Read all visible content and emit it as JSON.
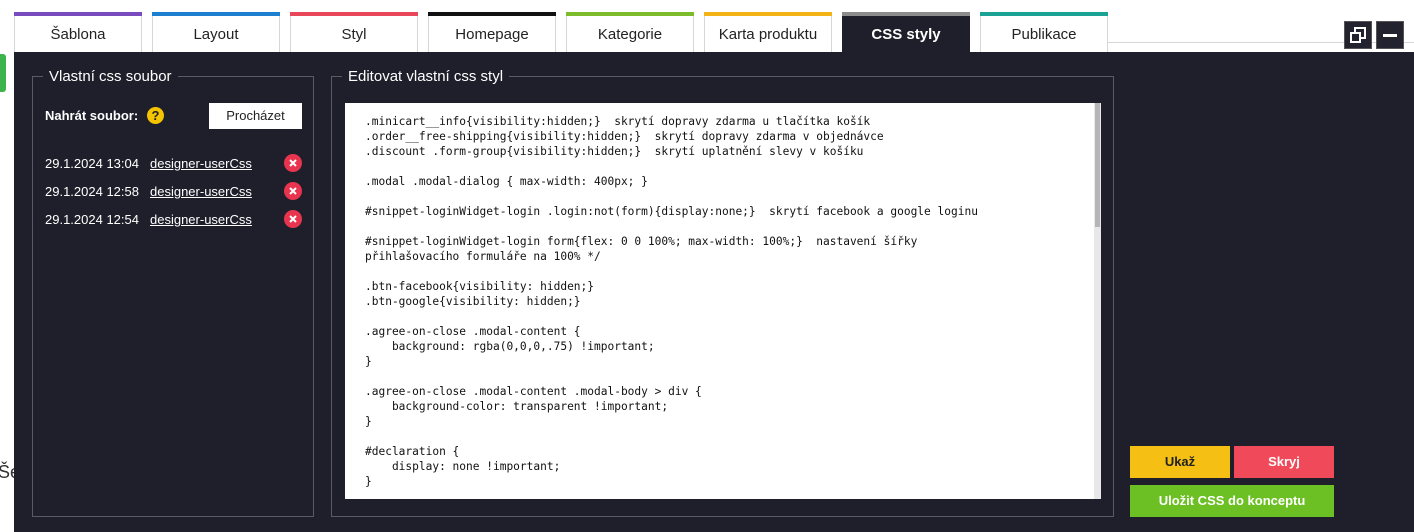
{
  "tabs": [
    {
      "label": "Šablona",
      "color": "#7a4bbf",
      "active": false
    },
    {
      "label": "Layout",
      "color": "#1e7fd1",
      "active": false
    },
    {
      "label": "Styl",
      "color": "#e8475a",
      "active": false
    },
    {
      "label": "Homepage",
      "color": "#111111",
      "active": false
    },
    {
      "label": "Kategorie",
      "color": "#7cbc2c",
      "active": false
    },
    {
      "label": "Karta produktu",
      "color": "#f3b316",
      "active": false
    },
    {
      "label": "CSS styly",
      "color": "#8c8c8c",
      "active": true
    },
    {
      "label": "Publikace",
      "color": "#1aa395",
      "active": false
    }
  ],
  "left_panel": {
    "title": "Vlastní css soubor",
    "upload_label": "Nahrát soubor:",
    "help_icon": "question-icon",
    "browse_label": "Procházet",
    "files": [
      {
        "date": "29.1.2024 13:04",
        "name": "designer-userCss"
      },
      {
        "date": "29.1.2024 12:58",
        "name": "designer-userCss"
      },
      {
        "date": "29.1.2024 12:54",
        "name": "designer-userCss"
      }
    ]
  },
  "right_panel": {
    "title": "Editovat vlastní css styl",
    "code": ".minicart__info{visibility:hidden;}  skrytí dopravy zdarma u tlačítka košík\n.order__free-shipping{visibility:hidden;}  skrytí dopravy zdarma v objednávce\n.discount .form-group{visibility:hidden;}  skrytí uplatnění slevy v košíku\n\n.modal .modal-dialog { max-width: 400px; }\n\n#snippet-loginWidget-login .login:not(form){display:none;}  skrytí facebook a google loginu\n\n#snippet-loginWidget-login form{flex: 0 0 100%; max-width: 100%;}  nastavení šířky\npřihlašovacího formuláře na 100% */\n\n.btn-facebook{visibility: hidden;}\n.btn-google{visibility: hidden;}\n\n.agree-on-close .modal-content {\n    background: rgba(0,0,0,.75) !important;\n}\n\n.agree-on-close .modal-content .modal-body > div {\n    background-color: transparent !important;\n}\n\n#declaration {\n    display: none !important;\n}"
  },
  "buttons": {
    "show": "Ukaž",
    "hide": "Skryj",
    "save": "Uložit CSS do konceptu"
  },
  "side_fragment": "Še",
  "colors": {
    "panel_bg": "#1f1f2b",
    "help": "#f5c400",
    "delete": "#e8344e",
    "show_btn": "#f5c013",
    "hide_btn": "#f04a5a",
    "save_btn": "#6cc024"
  }
}
